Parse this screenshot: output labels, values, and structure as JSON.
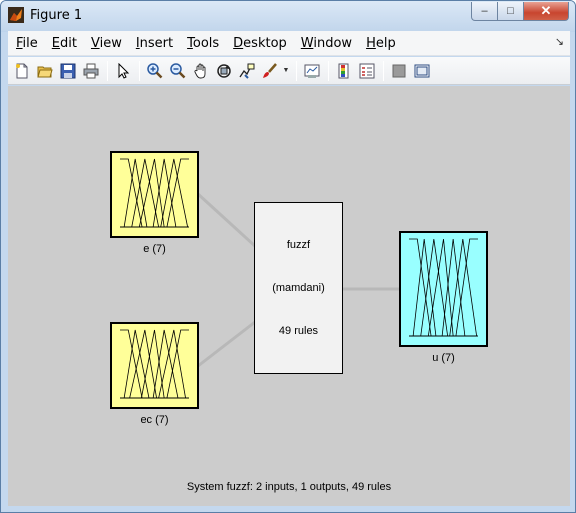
{
  "window": {
    "title": "Figure 1",
    "controls": {
      "minimize": "–",
      "maximize": "□",
      "close": "✕"
    }
  },
  "menubar": {
    "items": [
      {
        "label": "File",
        "name": "menu-file"
      },
      {
        "label": "Edit",
        "name": "menu-edit"
      },
      {
        "label": "View",
        "name": "menu-view"
      },
      {
        "label": "Insert",
        "name": "menu-insert"
      },
      {
        "label": "Tools",
        "name": "menu-tools"
      },
      {
        "label": "Desktop",
        "name": "menu-desktop"
      },
      {
        "label": "Window",
        "name": "menu-window"
      },
      {
        "label": "Help",
        "name": "menu-help"
      }
    ],
    "dock_glyph": "↘"
  },
  "toolbar": {
    "icons": [
      "new-figure-icon",
      "open-file-icon",
      "save-icon",
      "print-icon",
      "edit-plot-arrow-icon",
      "zoom-in-icon",
      "zoom-out-icon",
      "pan-hand-icon",
      "rotate-3d-icon",
      "data-cursor-icon",
      "brush-icon",
      "link-plot-icon",
      "colorbar-icon",
      "legend-icon",
      "hide-plot-tools-icon",
      "show-plot-tools-icon"
    ]
  },
  "fis": {
    "inputs": [
      {
        "label": "e (7)"
      },
      {
        "label": "ec (7)"
      }
    ],
    "system": {
      "name": "fuzzf",
      "type": "(mamdani)",
      "rules": "49 rules"
    },
    "outputs": [
      {
        "label": "u (7)"
      }
    ],
    "colors": {
      "input_block": "#ffff99",
      "output_block": "#99ffff",
      "system_block": "#f2f2f2",
      "background": "#cccccc"
    },
    "summary": "System fuzzf: 2 inputs, 1 outputs, 49 rules"
  }
}
